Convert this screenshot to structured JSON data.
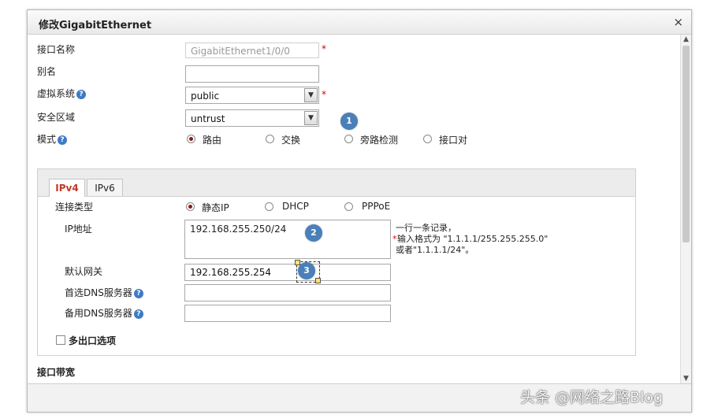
{
  "dialog": {
    "title": "修改GigabitEthernet",
    "close": "×"
  },
  "form": {
    "interface_name": {
      "label": "接口名称",
      "value": "GigabitEthernet1/0/0",
      "required": "*"
    },
    "alias": {
      "label": "别名",
      "value": ""
    },
    "vsys": {
      "label": "虚拟系统",
      "help": "?",
      "value": "public",
      "required": "*"
    },
    "zone": {
      "label": "安全区域",
      "value": "untrust"
    },
    "mode": {
      "label": "模式",
      "help": "?",
      "options": [
        "路由",
        "交换",
        "旁路检测",
        "接口对"
      ],
      "selected": 0
    }
  },
  "tabs": [
    "IPv4",
    "IPv6"
  ],
  "ipv4": {
    "conn_type": {
      "label": "连接类型",
      "options": [
        "静态IP",
        "DHCP",
        "PPPoE"
      ],
      "selected": 0
    },
    "ip": {
      "label": "IP地址",
      "value": "192.168.255.250/24",
      "hint1": "一行一条记录，",
      "hint_star": "*",
      "hint2": "输入格式为 \"1.1.1.1/255.255.255.0\"",
      "hint3": "或者\"1.1.1.1/24\"。"
    },
    "gateway": {
      "label": "默认网关",
      "value": "192.168.255.254"
    },
    "dns1": {
      "label": "首选DNS服务器",
      "help": "?",
      "value": ""
    },
    "dns2": {
      "label": "备用DNS服务器",
      "help": "?",
      "value": ""
    },
    "multi_exit": {
      "label": "多出口选项"
    }
  },
  "bandwidth": {
    "label": "接口带宽"
  },
  "badges": [
    "1",
    "2",
    "3"
  ],
  "watermark": "头条 @网络之路Blog",
  "icons": {
    "close": "close-icon",
    "dropdown": "chevron-down-icon",
    "help": "help-icon"
  },
  "colors": {
    "accent_radio": "#8b1a1a",
    "active_tab": "#c0392b",
    "badge": "#4a7fb9",
    "help": "#3d7bc4"
  }
}
